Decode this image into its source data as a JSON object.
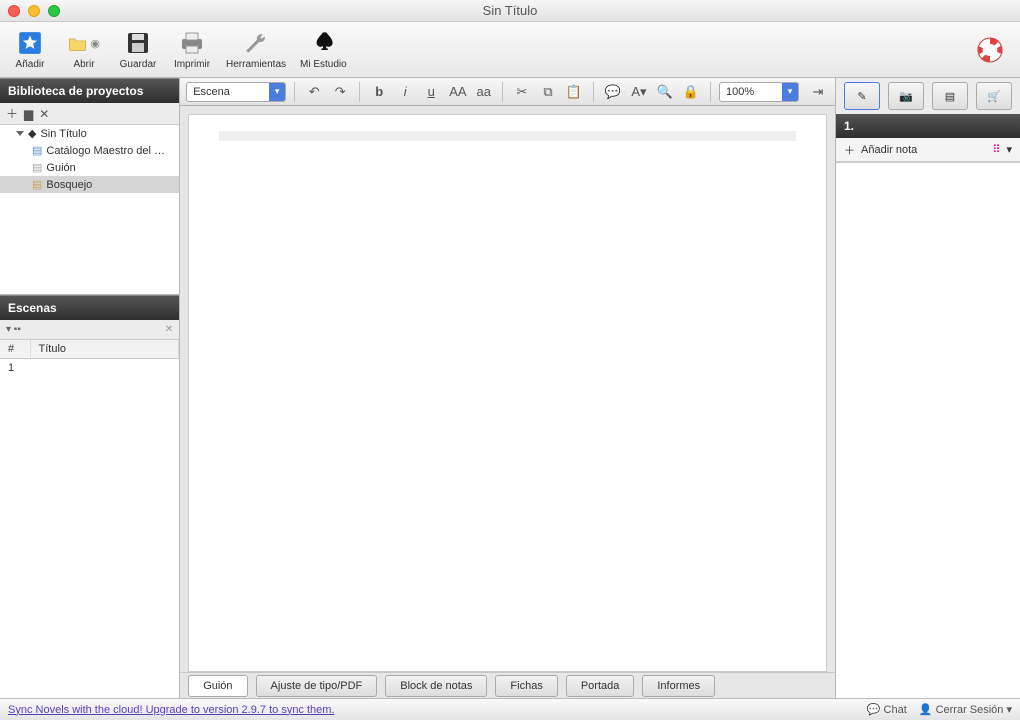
{
  "window": {
    "title": "Sin Título"
  },
  "toolbar": {
    "add": "Añadir",
    "open": "Abrir",
    "save": "Guardar",
    "print": "Imprimir",
    "tools": "Herramientas",
    "studio": "Mi Estudio"
  },
  "sidebar": {
    "library_title": "Biblioteca de proyectos",
    "tree": {
      "root": "Sin Título",
      "items": [
        "Catálogo Maestro del …",
        "Guión",
        "Bosquejo"
      ]
    },
    "scenes_title": "Escenas",
    "scenes_cols": {
      "num": "#",
      "title": "Título"
    },
    "scenes_rows": [
      {
        "num": "1",
        "title": ""
      }
    ]
  },
  "format_bar": {
    "element_type": "Escena",
    "bold": "b",
    "italic": "i",
    "underline": "u",
    "upper": "AA",
    "lower": "aa",
    "zoom": "100%"
  },
  "bottom_tabs": [
    "Guión",
    "Ajuste de tipo/PDF",
    "Block de notas",
    "Fichas",
    "Portada",
    "Informes"
  ],
  "right": {
    "section_num": "1.",
    "add_note": "Añadir nota"
  },
  "status": {
    "sync_msg": "Sync Novels with the cloud! Upgrade to version 2.9.7 to sync them.",
    "chat": "Chat",
    "logout": "Cerrar Sesión"
  }
}
